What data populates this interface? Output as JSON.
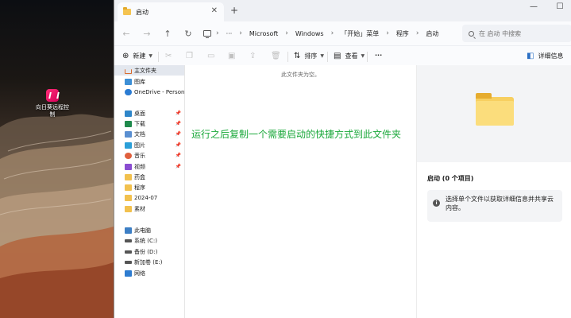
{
  "desktop": {
    "icon_label": "向日葵远程控制"
  },
  "tab": {
    "title": "启动",
    "close": "✕",
    "new_tab": "+"
  },
  "window_controls": {
    "minimize": "—",
    "maximize": "☐"
  },
  "nav": {
    "back": "←",
    "forward": "→",
    "up": "↑",
    "refresh": "↻",
    "more": "···",
    "chevron": "›"
  },
  "breadcrumb": [
    "Microsoft",
    "Windows",
    "「开始」菜单",
    "程序",
    "启动"
  ],
  "search": {
    "placeholder": "在 启动 中搜索"
  },
  "toolbar": {
    "new_label": "新建",
    "sort_label": "排序",
    "view_label": "查看",
    "more": "···",
    "details_label": "详细信息"
  },
  "sidebar": {
    "items": [
      {
        "label": "主文件夹",
        "icon": "home-icon"
      },
      {
        "label": "图库",
        "icon": "gallery-icon"
      },
      {
        "label": "OneDrive - Persona",
        "icon": "onedrive-icon"
      },
      {
        "label": "桌面",
        "icon": "desktop-icon"
      },
      {
        "label": "下载",
        "icon": "download-icon"
      },
      {
        "label": "文档",
        "icon": "documents-icon"
      },
      {
        "label": "图片",
        "icon": "pictures-icon"
      },
      {
        "label": "音乐",
        "icon": "music-icon"
      },
      {
        "label": "视频",
        "icon": "videos-icon"
      },
      {
        "label": "药盒",
        "icon": "folder-icon"
      },
      {
        "label": "程序",
        "icon": "folder-icon"
      },
      {
        "label": "2024-07",
        "icon": "folder-icon"
      },
      {
        "label": "素材",
        "icon": "folder-icon"
      },
      {
        "label": "此电脑",
        "icon": "this-pc-icon"
      },
      {
        "label": "系统 (C:)",
        "icon": "drive-icon"
      },
      {
        "label": "备份 (D:)",
        "icon": "drive-icon"
      },
      {
        "label": "新加卷 (E:)",
        "icon": "drive-icon"
      },
      {
        "label": "网络",
        "icon": "network-icon"
      }
    ]
  },
  "content": {
    "empty_message": "此文件夹为空。",
    "overlay_text": "运行之后复制一个需要启动的快捷方式到此文件夹"
  },
  "details": {
    "title": "启动 (0 个项目)",
    "info": "选择单个文件以获取详细信息并共享云内容。"
  }
}
